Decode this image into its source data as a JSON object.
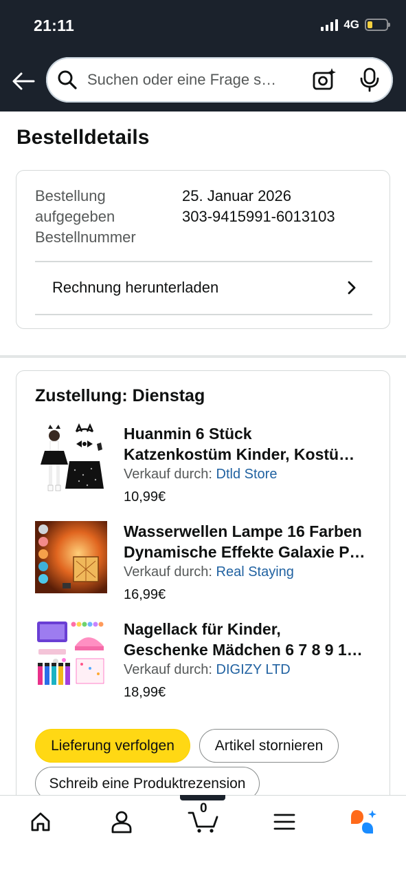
{
  "status_bar": {
    "time": "21:11",
    "network": "4G"
  },
  "search": {
    "placeholder": "Suchen oder eine Frage s…"
  },
  "page": {
    "title": "Bestelldetails"
  },
  "order_summary": {
    "labels": [
      "Bestellung",
      "aufgegeben",
      "Bestellnummer"
    ],
    "values": [
      "25. Januar 2026",
      "303-9415991-6013103"
    ],
    "invoice_label": "Rechnung herunterladen"
  },
  "delivery": {
    "title": "Zustellung: Dienstag",
    "seller_prefix": "Verkauf durch:",
    "items": [
      {
        "title_line1": "Huanmin 6 Stück",
        "title_line2": "Katzenkostüm Kinder, Kostü…",
        "seller": "Dtld Store",
        "price": "10,99€"
      },
      {
        "title_line1": "Wasserwellen Lampe 16 Farben",
        "title_line2": "Dynamische Effekte Galaxie P…",
        "seller": "Real Staying",
        "price": "16,99€"
      },
      {
        "title_line1": "Nagellack für Kinder,",
        "title_line2": "Geschenke Mädchen 6 7 8 9 1…",
        "seller": "DIGIZY LTD",
        "price": "18,99€"
      }
    ],
    "buttons": {
      "track": "Lieferung verfolgen",
      "cancel": "Artikel stornieren",
      "review": "Schreib eine Produktrezension"
    }
  },
  "bottom_nav": {
    "cart_count": "0"
  },
  "colors": {
    "header_bg": "#1b222c",
    "accent_yellow": "#ffd814",
    "link_blue": "#2162a1",
    "rufus_orange": "#ff6a1a",
    "rufus_blue": "#1a8cff"
  }
}
